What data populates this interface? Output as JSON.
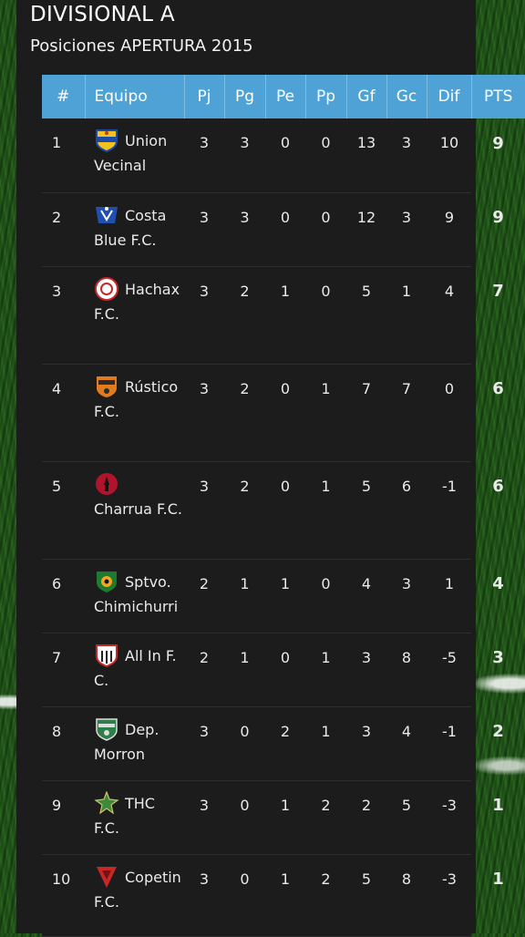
{
  "header": {
    "title": "DIVISIONAL A",
    "subtitle": "Posiciones APERTURA 2015"
  },
  "table": {
    "columns": [
      "#",
      "Equipo",
      "Pj",
      "Pg",
      "Pe",
      "Pp",
      "Gf",
      "Gc",
      "Dif",
      "PTS"
    ],
    "rows": [
      {
        "rank": "1",
        "team": "Union Vecinal",
        "pj": "3",
        "pg": "3",
        "pe": "0",
        "pp": "0",
        "gf": "13",
        "gc": "3",
        "dif": "10",
        "pts": "9",
        "logo": "union-vecinal-crest-icon"
      },
      {
        "rank": "2",
        "team": "Costa Blue F.C.",
        "pj": "3",
        "pg": "3",
        "pe": "0",
        "pp": "0",
        "gf": "12",
        "gc": "3",
        "dif": "9",
        "pts": "9",
        "logo": "costa-blue-crest-icon"
      },
      {
        "rank": "3",
        "team": "Hachax F.C.",
        "pj": "3",
        "pg": "2",
        "pe": "1",
        "pp": "0",
        "gf": "5",
        "gc": "1",
        "dif": "4",
        "pts": "7",
        "logo": "hachax-crest-icon"
      },
      {
        "rank": "4",
        "team": "Rústico F.C.",
        "pj": "3",
        "pg": "2",
        "pe": "0",
        "pp": "1",
        "gf": "7",
        "gc": "7",
        "dif": "0",
        "pts": "6",
        "logo": "rustico-crest-icon"
      },
      {
        "rank": "5",
        "team": "Charrua F.C.",
        "pj": "3",
        "pg": "2",
        "pe": "0",
        "pp": "1",
        "gf": "5",
        "gc": "6",
        "dif": "-1",
        "pts": "6",
        "logo": "charrua-crest-icon"
      },
      {
        "rank": "6",
        "team": "Sptvo. Chimichurri",
        "pj": "2",
        "pg": "1",
        "pe": "1",
        "pp": "0",
        "gf": "4",
        "gc": "3",
        "dif": "1",
        "pts": "4",
        "logo": "chimichurri-crest-icon"
      },
      {
        "rank": "7",
        "team": "All In F. C.",
        "pj": "2",
        "pg": "1",
        "pe": "0",
        "pp": "1",
        "gf": "3",
        "gc": "8",
        "dif": "-5",
        "pts": "3",
        "logo": "all-in-crest-icon"
      },
      {
        "rank": "8",
        "team": "Dep. Morron",
        "pj": "3",
        "pg": "0",
        "pe": "2",
        "pp": "1",
        "gf": "3",
        "gc": "4",
        "dif": "-1",
        "pts": "2",
        "logo": "morron-crest-icon"
      },
      {
        "rank": "9",
        "team": "THC F.C.",
        "pj": "3",
        "pg": "0",
        "pe": "1",
        "pp": "2",
        "gf": "2",
        "gc": "5",
        "dif": "-3",
        "pts": "1",
        "logo": "thc-crest-icon"
      },
      {
        "rank": "10",
        "team": "Copetin F.C.",
        "pj": "3",
        "pg": "0",
        "pe": "1",
        "pp": "2",
        "gf": "5",
        "gc": "8",
        "dif": "-3",
        "pts": "1",
        "logo": "copetin-crest-icon"
      }
    ]
  },
  "colors": {
    "header_bg": "#4fa2d6",
    "panel_bg": "#1c1c1c"
  }
}
